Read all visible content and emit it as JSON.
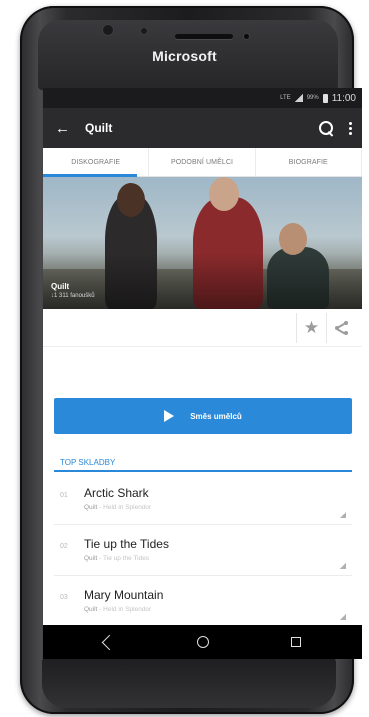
{
  "device": {
    "brand": "Microsoft"
  },
  "status_bar": {
    "network": "LTE",
    "battery": "99%",
    "time": "11:00"
  },
  "app_bar": {
    "back_icon": "arrow-left-icon",
    "title": "Quilt",
    "search_icon": "search-icon",
    "more_icon": "more-vert-icon"
  },
  "tabs": [
    {
      "label": "DISKOGRAFIE",
      "active": true
    },
    {
      "label": "PODOBNÍ UMĚLCI",
      "active": false
    },
    {
      "label": "BIOGRAFIE",
      "active": false
    }
  ],
  "hero": {
    "artist": "Quilt",
    "fans": "↓1 311 fanoušků"
  },
  "actions": {
    "favorite_icon": "star-icon",
    "share_icon": "share-icon"
  },
  "mix_button": {
    "icon": "play-icon",
    "label": "Směs umělců"
  },
  "section": {
    "title": "TOP SKLADBY"
  },
  "tracks": [
    {
      "number": "01",
      "title": "Arctic Shark",
      "artist": "Quilt",
      "album": "Held in Splendor"
    },
    {
      "number": "02",
      "title": "Tie up the Tides",
      "artist": "Quilt",
      "album": "Tie up the Tides"
    },
    {
      "number": "03",
      "title": "Mary Mountain",
      "artist": "Quilt",
      "album": "Held in Splendor"
    }
  ],
  "colors": {
    "accent": "#2a88d8",
    "app_bar": "#2b2b2e",
    "status_bar": "#1b1b1d",
    "nav_bar": "#000000"
  }
}
